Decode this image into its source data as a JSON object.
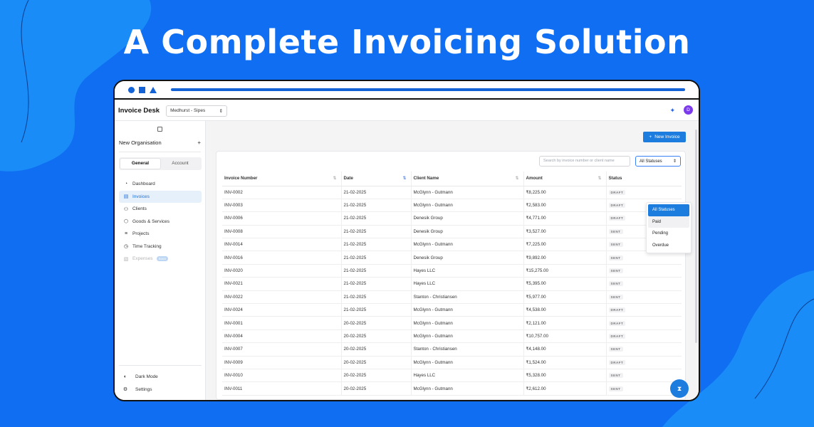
{
  "headline": "A Complete Invoicing Solution",
  "colors": {
    "background": "#0f6ef2",
    "accent": "#1d7ddf",
    "frame_accent": "#1463d6"
  },
  "topbar": {
    "brand": "Invoice Desk",
    "organization": "Medhurst - Sipes",
    "avatar_initial": "D"
  },
  "sidebar": {
    "org_name": "New Organisation",
    "tabs": [
      {
        "label": "General"
      },
      {
        "label": "Account"
      }
    ],
    "items": [
      {
        "label": "Dashboard",
        "icon": "dashboard-icon"
      },
      {
        "label": "Invoices",
        "icon": "document-icon"
      },
      {
        "label": "Clients",
        "icon": "users-icon"
      },
      {
        "label": "Goods & Services",
        "icon": "box-icon"
      },
      {
        "label": "Projects",
        "icon": "list-icon"
      },
      {
        "label": "Time Tracking",
        "icon": "clock-icon"
      },
      {
        "label": "Expenses",
        "icon": "receipt-icon",
        "badge": "Soon"
      }
    ],
    "bottom_items": [
      {
        "label": "Dark Mode",
        "icon": "moon-icon"
      },
      {
        "label": "Settings",
        "icon": "gear-icon"
      }
    ]
  },
  "main": {
    "new_invoice_label": "New Invoice",
    "search_placeholder": "Search by invoice number or client name",
    "status_filter": "All Statuses",
    "status_options": [
      "All Statuses",
      "Paid",
      "Pending",
      "Overdue"
    ],
    "columns": [
      "Invoice Number",
      "Date",
      "Client Name",
      "Amount",
      "Status"
    ],
    "rows": [
      {
        "number": "INV-0002",
        "date": "21-02-2025",
        "client": "McGlynn - Gutmann",
        "amount": "₹8,225.00",
        "status": "DRAFT"
      },
      {
        "number": "INV-0003",
        "date": "21-02-2025",
        "client": "McGlynn - Gutmann",
        "amount": "₹2,583.00",
        "status": "DRAFT"
      },
      {
        "number": "INV-0006",
        "date": "21-02-2025",
        "client": "Denesik Group",
        "amount": "₹4,771.00",
        "status": "DRAFT"
      },
      {
        "number": "INV-0008",
        "date": "21-02-2025",
        "client": "Denesik Group",
        "amount": "₹3,527.00",
        "status": "SENT"
      },
      {
        "number": "INV-0014",
        "date": "21-02-2025",
        "client": "McGlynn - Gutmann",
        "amount": "₹7,225.00",
        "status": "SENT"
      },
      {
        "number": "INV-0016",
        "date": "21-02-2025",
        "client": "Denesik Group",
        "amount": "₹9,892.00",
        "status": "SENT"
      },
      {
        "number": "INV-0020",
        "date": "21-02-2025",
        "client": "Hayes LLC",
        "amount": "₹15,275.00",
        "status": "SENT"
      },
      {
        "number": "INV-0021",
        "date": "21-02-2025",
        "client": "Hayes LLC",
        "amount": "₹5,395.00",
        "status": "SENT"
      },
      {
        "number": "INV-0022",
        "date": "21-02-2025",
        "client": "Stanton - Christiansen",
        "amount": "₹5,977.00",
        "status": "SENT"
      },
      {
        "number": "INV-0024",
        "date": "21-02-2025",
        "client": "McGlynn - Gutmann",
        "amount": "₹4,538.00",
        "status": "DRAFT"
      },
      {
        "number": "INV-0001",
        "date": "20-02-2025",
        "client": "McGlynn - Gutmann",
        "amount": "₹2,121.00",
        "status": "DRAFT"
      },
      {
        "number": "INV-0004",
        "date": "20-02-2025",
        "client": "McGlynn - Gutmann",
        "amount": "₹10,757.00",
        "status": "DRAFT"
      },
      {
        "number": "INV-0007",
        "date": "20-02-2025",
        "client": "Stanton - Christiansen",
        "amount": "₹4,148.00",
        "status": "SENT"
      },
      {
        "number": "INV-0009",
        "date": "20-02-2025",
        "client": "McGlynn - Gutmann",
        "amount": "₹1,524.00",
        "status": "DRAFT"
      },
      {
        "number": "INV-0010",
        "date": "20-02-2025",
        "client": "Hayes LLC",
        "amount": "₹5,328.00",
        "status": "SENT"
      },
      {
        "number": "INV-0011",
        "date": "20-02-2025",
        "client": "McGlynn - Gutmann",
        "amount": "₹2,612.00",
        "status": "SENT"
      }
    ]
  }
}
